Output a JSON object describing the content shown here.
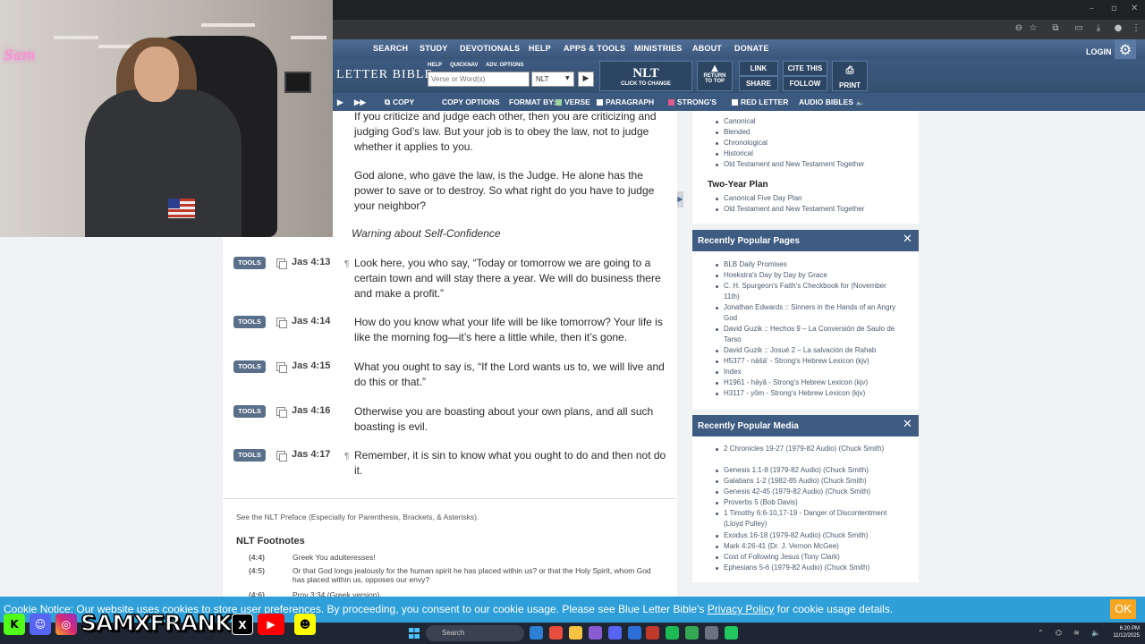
{
  "colors": {
    "nav_bg": "#3d5a80",
    "card_head": "#3e5b82",
    "cookie_bg": "#2e9fd8",
    "ok_btn": "#f5a623",
    "tools_btn": "#5a6f8a"
  },
  "nav": {
    "items": [
      "SEARCH",
      "STUDY",
      "DEVOTIONALS",
      "HELP",
      "APPS & TOOLS",
      "MINISTRIES",
      "ABOUT",
      "DONATE"
    ],
    "login": "LOGIN",
    "settings_icon": "gear-icon"
  },
  "toolbar": {
    "logo": "LETTER BIBLE",
    "help": "HELP",
    "quicknav": "QUICKNAV",
    "adv_options": "ADV. OPTIONS",
    "search_placeholder": "Verse or Word(s)",
    "version": "NLT",
    "version_big": "NLT",
    "click_to_change": "CLICK TO CHANGE",
    "return_line1": "RETURN",
    "return_line2": "TO TOP",
    "link": "LINK",
    "share": "SHARE",
    "cite": "CITE THIS",
    "follow": "FOLLOW",
    "print": "PRINT"
  },
  "options": {
    "copy": "COPY",
    "copy_options": "COPY OPTIONS",
    "format_by": "FORMAT BY:",
    "verse": "VERSE",
    "paragraph": "PARAGRAPH",
    "strongs": "STRONG'S",
    "red_letter": "RED LETTER",
    "audio_bibles": "AUDIO BIBLES"
  },
  "content": {
    "para1": "If you criticize and judge each other, then you are criticizing and judging God’s law. But your job is to obey the law, not to judge whether it applies to you.",
    "para2": "God alone, who gave the law, is the Judge. He alone has the power to save or to destroy. So what right do you have to judge your neighbor?",
    "section_heading": "Warning about Self-Confidence",
    "tools_label": "TOOLS",
    "verses": [
      {
        "ref": "Jas 4:13",
        "text": "Look here, you who say, “Today or tomorrow we are going to a certain town and will stay there a year. We will do business there and make a profit.”"
      },
      {
        "ref": "Jas 4:14",
        "text": "How do you know what your life will be like tomorrow? Your life is like the morning fog—it’s here a little while, then it’s gone."
      },
      {
        "ref": "Jas 4:15",
        "text": "What you ought to say is, “If the Lord wants us to, we will live and do this or that.”"
      },
      {
        "ref": "Jas 4:16",
        "text": "Otherwise you are boasting about your own plans, and all such boasting is evil."
      },
      {
        "ref": "Jas 4:17",
        "text": "Remember, it is sin to know what you ought to do and then not do it."
      }
    ],
    "preface": "See the NLT Preface (Especially for Parenthesis, Brackets, & Asterisks).",
    "footnotes_title": "NLT Footnotes",
    "footnotes": [
      {
        "ref": "(4:4)",
        "text": "Greek You adulteresses!"
      },
      {
        "ref": "(4:5)",
        "text": "Or that God longs jealously for the human spirit he has placed within us? or that the Holy Spirit, whom God has placed within us, opposes our envy?"
      },
      {
        "ref": "(4:6)",
        "text": "Prov 3:34 (Greek version)."
      }
    ]
  },
  "sidebar": {
    "plans": [
      "Canonical",
      "Blended",
      "Chronological",
      "Historical",
      "Old Testament and New Testament Together"
    ],
    "two_year_title": "Two-Year Plan",
    "two_year": [
      "Canonical Five Day Plan",
      "Old Testament and New Testament Together"
    ],
    "popular_pages_title": "Recently Popular Pages",
    "popular_pages": [
      "BLB Daily Promises",
      "Hoekstra's Day by Day by Grace",
      "C. H. Spurgeon's Faith's Checkbook for (November 11th)",
      "Jonathan Edwards :: Sinners in the Hands of an Angry God",
      "David Guzik :: Hechos 9 – La Conversión de Saulo de Tarso",
      "David Guzik :: Josué 2 – La salvación de Rahab",
      "H5377 - nāšā' - Strong's Hebrew Lexicon (kjv)",
      "Index",
      "H1961 - hāyâ - Strong's Hebrew Lexicon (kjv)",
      "H3117 - yôm - Strong's Hebrew Lexicon (kjv)"
    ],
    "popular_media_title": "Recently Popular Media",
    "popular_media": [
      "2 Chronicles 19-27 (1979-82 Audio) (Chuck Smith)",
      "Genesis 1:1-8 (1979-82 Audio) (Chuck Smith)",
      "Galatians 1-2 (1982-85 Audio) (Chuck Smith)",
      "Genesis 42-45 (1979-82 Audio) (Chuck Smith)",
      "Proverbs 5 (Bob Davis)",
      "1 Timothy 6:6-10,17-19 - Danger of Discontentment (Lloyd Pulley)",
      "Exodus 16-18 (1979-82 Audio) (Chuck Smith)",
      "Mark 4:26-41 (Dr. J. Vernon McGee)",
      "Cost of Following Jesus (Tony Clark)",
      "Ephesians 5-6 (1979-82 Audio) (Chuck Smith)"
    ]
  },
  "cookie": {
    "text_before": "Cookie Notice: Our website uses cookies to store user preferences. By proceeding, you consent to our cookie usage. Please see Blue Letter Bible's ",
    "link": "Privacy Policy",
    "text_after": " for cookie usage details.",
    "ok": "OK"
  },
  "stream": {
    "handle": "SAMXFRANK",
    "neon": "Sam"
  },
  "taskbar": {
    "search": "Search",
    "time": "6:20 PM",
    "date": "11/12/2025"
  }
}
